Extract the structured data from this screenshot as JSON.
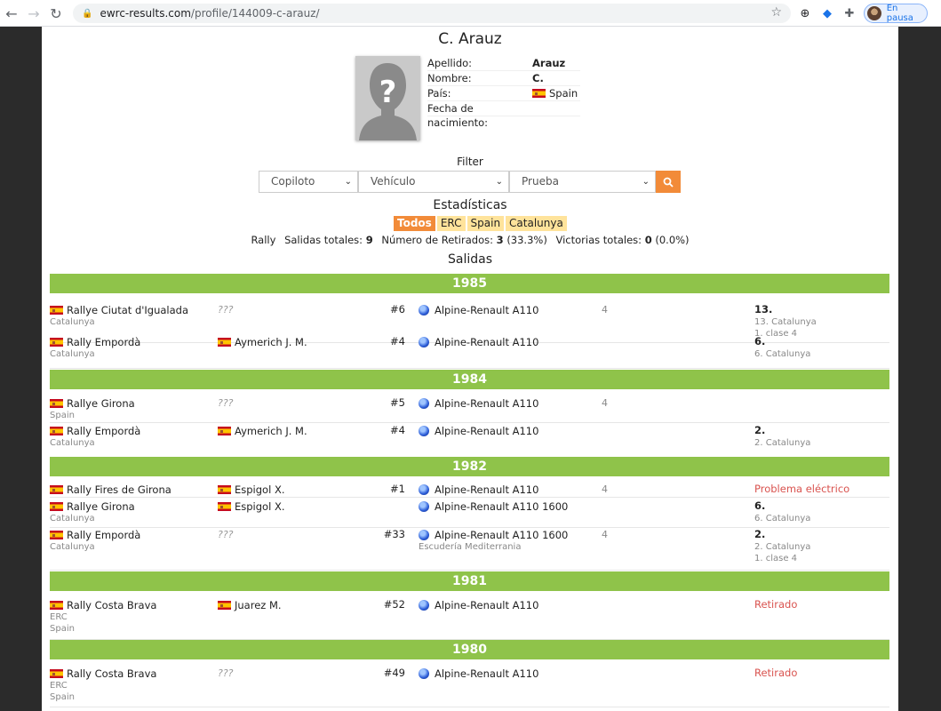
{
  "browser": {
    "url_host": "ewrc-results.com",
    "url_path": "/profile/144009-c-arauz/",
    "profile_status": "En pausa"
  },
  "profile": {
    "name": "C. Arauz",
    "fields": [
      {
        "label": "Apellido:",
        "value": "Arauz"
      },
      {
        "label": "Nombre:",
        "value": "C."
      },
      {
        "label": "País:",
        "value": "Spain"
      },
      {
        "label": "Fecha de nacimiento:",
        "value": ""
      }
    ]
  },
  "filter": {
    "title": "Filter",
    "copiloto": "Copiloto",
    "vehiculo": "Vehículo",
    "prueba": "Prueba"
  },
  "stats": {
    "title": "Estadísticas",
    "tabs": [
      "Todos",
      "ERC",
      "Spain",
      "Catalunya"
    ],
    "active_tab": "Todos",
    "rally_label": "Rally",
    "salidas_label": "Salidas totales:",
    "salidas_value": "9",
    "retirados_label": "Número de Retirados:",
    "retirados_value": "3",
    "retirados_pct": "(33.3%)",
    "victorias_label": "Victorias totales:",
    "victorias_value": "0",
    "victorias_pct": "(0.0%)"
  },
  "salidas_title": "Salidas",
  "years": [
    {
      "year": "1985",
      "rows": [
        {
          "event": "Rallye Ciutat d'Igualada",
          "sub": [
            "Catalunya"
          ],
          "codriver": "???",
          "num": "#6",
          "car": "Alpine-Renault A110",
          "team": "",
          "cls": "4",
          "result": "13.",
          "result_sub": [
            "13. Catalunya",
            "1. clase 4"
          ]
        },
        {
          "event": "Rally Empordà",
          "sub": [
            "Catalunya"
          ],
          "codriver": "Aymerich J. M.",
          "num": "#4",
          "car": "Alpine-Renault A110",
          "team": "",
          "cls": "",
          "result": "6.",
          "result_sub": [
            "6. Catalunya"
          ]
        }
      ]
    },
    {
      "year": "1984",
      "rows": [
        {
          "event": "Rallye Girona",
          "sub": [
            "Spain"
          ],
          "codriver": "???",
          "num": "#5",
          "car": "Alpine-Renault A110",
          "team": "",
          "cls": "4",
          "result": "",
          "result_sub": []
        },
        {
          "event": "Rally Empordà",
          "sub": [
            "Catalunya"
          ],
          "codriver": "Aymerich J. M.",
          "num": "#4",
          "car": "Alpine-Renault A110",
          "team": "",
          "cls": "",
          "result": "2.",
          "result_sub": [
            "2. Catalunya"
          ]
        }
      ]
    },
    {
      "year": "1982",
      "rows": [
        {
          "event": "Rally Fires de Girona",
          "sub": [],
          "codriver": "Espigol X.",
          "num": "#1",
          "car": "Alpine-Renault A110",
          "team": "",
          "cls": "4",
          "result": "Problema eléctrico",
          "result_sub": []
        },
        {
          "event": "Rallye Girona",
          "sub": [
            "Catalunya"
          ],
          "codriver": "Espigol X.",
          "num": "",
          "car": "Alpine-Renault A110 1600",
          "team": "",
          "cls": "",
          "result": "6.",
          "result_sub": [
            "6. Catalunya"
          ]
        },
        {
          "event": "Rally Empordà",
          "sub": [
            "Catalunya"
          ],
          "codriver": "???",
          "num": "#33",
          "car": "Alpine-Renault A110 1600",
          "team": "Escudería Mediterrania",
          "cls": "4",
          "result": "2.",
          "result_sub": [
            "2. Catalunya",
            "1. clase 4"
          ]
        }
      ]
    },
    {
      "year": "1981",
      "rows": [
        {
          "event": "Rally Costa Brava",
          "sub": [
            "ERC",
            "Spain"
          ],
          "codriver": "Juarez M.",
          "num": "#52",
          "car": "Alpine-Renault A110",
          "team": "",
          "cls": "",
          "result": "Retirado",
          "result_sub": []
        }
      ]
    },
    {
      "year": "1980",
      "rows": [
        {
          "event": "Rally Costa Brava",
          "sub": [
            "ERC",
            "Spain"
          ],
          "codriver": "???",
          "num": "#49",
          "car": "Alpine-Renault A110",
          "team": "",
          "cls": "",
          "result": "Retirado",
          "result_sub": []
        }
      ]
    }
  ]
}
